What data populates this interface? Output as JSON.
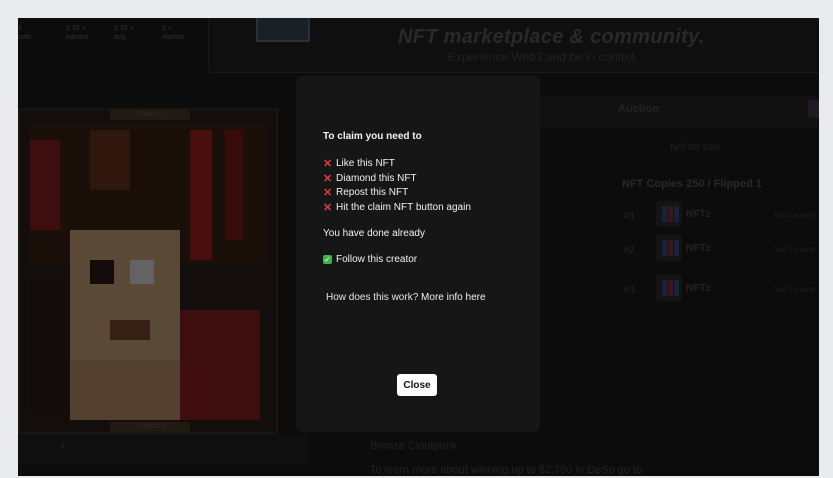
{
  "stats": [
    {
      "value": "1",
      "label": "sold"
    },
    {
      "value": "2.32 »",
      "label": "earned"
    },
    {
      "value": "2.32 »",
      "label": "avg."
    },
    {
      "value": "2 »",
      "label": "market"
    }
  ],
  "hero": {
    "title": "NFT marketplace & community.",
    "subtitle": "Experience Web3 and be in control."
  },
  "art": {
    "top_label": "Season 1",
    "bottom_label": "Cloutpunk"
  },
  "side": {
    "auction_label": "Auction",
    "not_for_sale": "Not for sale",
    "copies_title": "NFT Copies 250 / Flipped 1"
  },
  "copies": [
    {
      "num": "#1",
      "name": "NFTz",
      "status": "Not for sale"
    },
    {
      "num": "#2",
      "name": "NFTz",
      "status": "Not for sale"
    },
    {
      "num": "#3",
      "name": "NFTz",
      "status": "Not for sale"
    }
  ],
  "bottom": {
    "collection": "Bronze Cloutpunk",
    "learn": "To learn more about winning up to $2,750 in DeSo go to"
  },
  "modal": {
    "heading": "To claim you need to",
    "requirements": [
      "Like this NFT",
      "Diamond this NFT",
      "Repost this NFT",
      "Hit the claim NFT button again"
    ],
    "done_heading": "You have done already",
    "done_items": [
      "Follow this creator"
    ],
    "how_question": "How does this work?",
    "more_info_link": "More info here",
    "close_label": "Close"
  },
  "colors": {
    "error": "#e53b3b",
    "success": "#3fb44a",
    "modal_bg": "#161616"
  }
}
